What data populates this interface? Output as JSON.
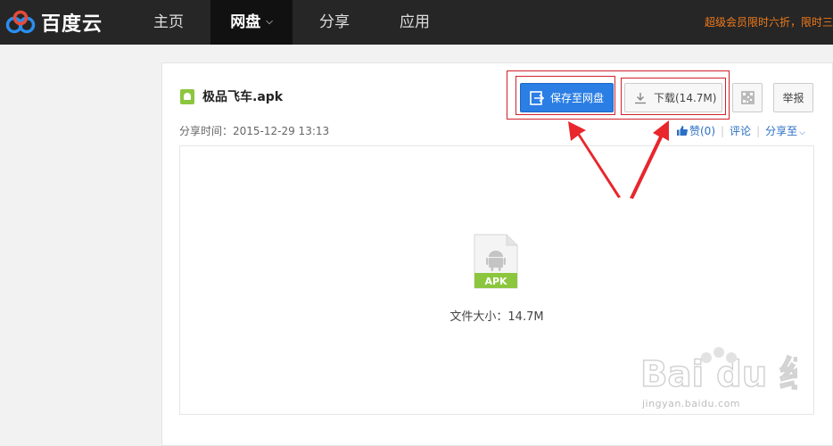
{
  "header": {
    "logo_text": "百度云",
    "nav": [
      {
        "label": "主页"
      },
      {
        "label": "网盘"
      },
      {
        "label": "分享"
      },
      {
        "label": "应用"
      }
    ],
    "promo": "超级会员限时六折，限时三"
  },
  "file": {
    "name": "极品飞车.apk",
    "share_time": "分享时间：2015-12-29 13:13",
    "type_label": "APK",
    "size_text": "文件大小：14.7M"
  },
  "toolbar": {
    "save_label": "保存至网盘",
    "download_label": "下载(14.7M)",
    "report_label": "举报"
  },
  "actions": {
    "like_label": "赞(0)",
    "comment_label": "评论",
    "share_label": "分享至"
  },
  "watermark": {
    "brand": "Bai du 经验",
    "url": "jingyan.baidu.com"
  },
  "colors": {
    "accent": "#2a7ee4",
    "highlight": "#d0212a",
    "apk_green": "#8cc63f",
    "promo": "#f07a1c"
  }
}
